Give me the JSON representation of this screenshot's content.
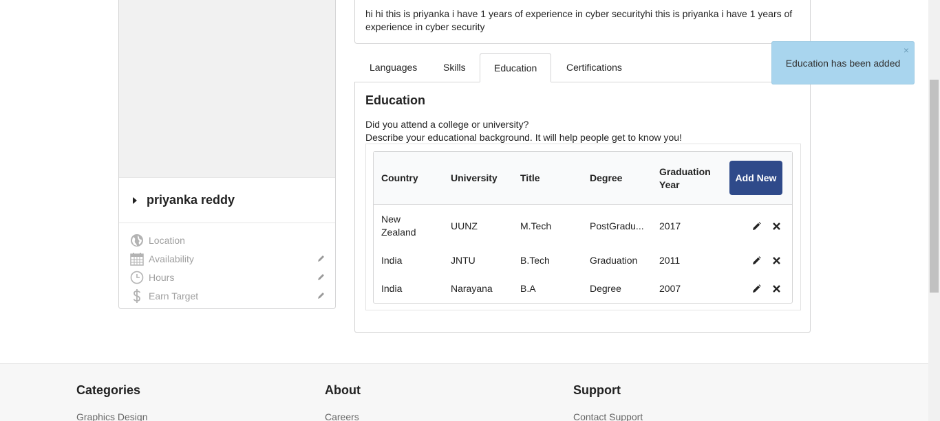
{
  "profile": {
    "name": "priyanka reddy",
    "meta": [
      {
        "label": "Location",
        "icon": "globe-icon",
        "editable": false
      },
      {
        "label": "Availability",
        "icon": "calendar-icon",
        "editable": true
      },
      {
        "label": "Hours",
        "icon": "clock-icon",
        "editable": true
      },
      {
        "label": "Earn Target",
        "icon": "dollar-icon",
        "editable": true
      }
    ]
  },
  "summary": {
    "text": "hi hi this is priyanka i have 1 years of experience in cyber securityhi this is priyanka i have 1 years of experience in cyber security"
  },
  "tabs": [
    {
      "label": "Languages",
      "active": false
    },
    {
      "label": "Skills",
      "active": false
    },
    {
      "label": "Education",
      "active": true
    },
    {
      "label": "Certifications",
      "active": false
    }
  ],
  "education": {
    "title": "Education",
    "question": "Did you attend a college or university?",
    "description": "Describe your educational background. It will help people get to know you!",
    "columns": [
      "Country",
      "University",
      "Title",
      "Degree",
      "Graduation Year"
    ],
    "add_label": "Add New",
    "rows": [
      {
        "country": "New Zealand",
        "university": "UUNZ",
        "title": "M.Tech",
        "degree": "PostGradu...",
        "year": "2017"
      },
      {
        "country": "India",
        "university": "JNTU",
        "title": "B.Tech",
        "degree": "Graduation",
        "year": "2011"
      },
      {
        "country": "India",
        "university": "Narayana",
        "title": "B.A",
        "degree": "Degree",
        "year": "2007"
      }
    ]
  },
  "toast": {
    "message": "Education has been added",
    "close": "×"
  },
  "footer": {
    "columns": [
      {
        "heading": "Categories",
        "link": "Graphics Design"
      },
      {
        "heading": "About",
        "link": "Careers"
      },
      {
        "heading": "Support",
        "link": "Contact Support"
      }
    ]
  },
  "colors": {
    "accent": "#2f4a8a",
    "toast_bg": "#a9d5ee",
    "muted": "#a0a0a0"
  }
}
